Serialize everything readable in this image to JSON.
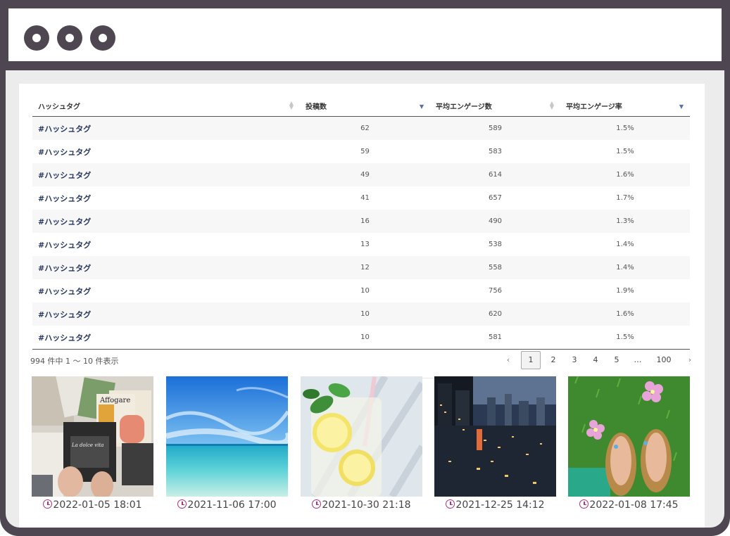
{
  "window": {
    "controls": [
      "window-dot-1",
      "window-dot-2",
      "window-dot-3"
    ]
  },
  "table": {
    "headers": {
      "hashtag": "ハッシュタグ",
      "posts": "投稿数",
      "avg_engagement": "平均エンゲージ数",
      "avg_engagement_rate": "平均エンゲージ率"
    },
    "rows": [
      {
        "tag": "#ハッシュタグ",
        "posts": "62",
        "eng": "589",
        "rate": "1.5%"
      },
      {
        "tag": "#ハッシュタグ",
        "posts": "59",
        "eng": "583",
        "rate": "1.5%"
      },
      {
        "tag": "#ハッシュタグ",
        "posts": "49",
        "eng": "614",
        "rate": "1.6%"
      },
      {
        "tag": "#ハッシュタグ",
        "posts": "41",
        "eng": "657",
        "rate": "1.7%"
      },
      {
        "tag": "#ハッシュタグ",
        "posts": "16",
        "eng": "490",
        "rate": "1.3%"
      },
      {
        "tag": "#ハッシュタグ",
        "posts": "13",
        "eng": "538",
        "rate": "1.4%"
      },
      {
        "tag": "#ハッシュタグ",
        "posts": "12",
        "eng": "558",
        "rate": "1.4%"
      },
      {
        "tag": "#ハッシュタグ",
        "posts": "10",
        "eng": "756",
        "rate": "1.9%"
      },
      {
        "tag": "#ハッシュタグ",
        "posts": "10",
        "eng": "620",
        "rate": "1.6%"
      },
      {
        "tag": "#ハッシュタグ",
        "posts": "10",
        "eng": "581",
        "rate": "1.5%"
      }
    ]
  },
  "info": "994 件中 1 〜 10 件表示",
  "pagination": {
    "prev": "‹",
    "pages": [
      "1",
      "2",
      "3",
      "4",
      "5",
      "…",
      "100"
    ],
    "current": "1",
    "next": "›"
  },
  "posts": [
    {
      "date": "2022-01-05 18:01",
      "image": "magazines-reading"
    },
    {
      "date": "2021-11-06 17:00",
      "image": "ocean-sky"
    },
    {
      "date": "2021-10-30 21:18",
      "image": "lemonade-glass"
    },
    {
      "date": "2021-12-25 14:12",
      "image": "city-night"
    },
    {
      "date": "2022-01-08 17:45",
      "image": "sandals-grass-flowers"
    }
  ],
  "colors": {
    "frame": "#4e4650",
    "accent_clock": "#b0327a",
    "hashtag_text": "#26375f",
    "sort_active": "#5a6fa8"
  }
}
